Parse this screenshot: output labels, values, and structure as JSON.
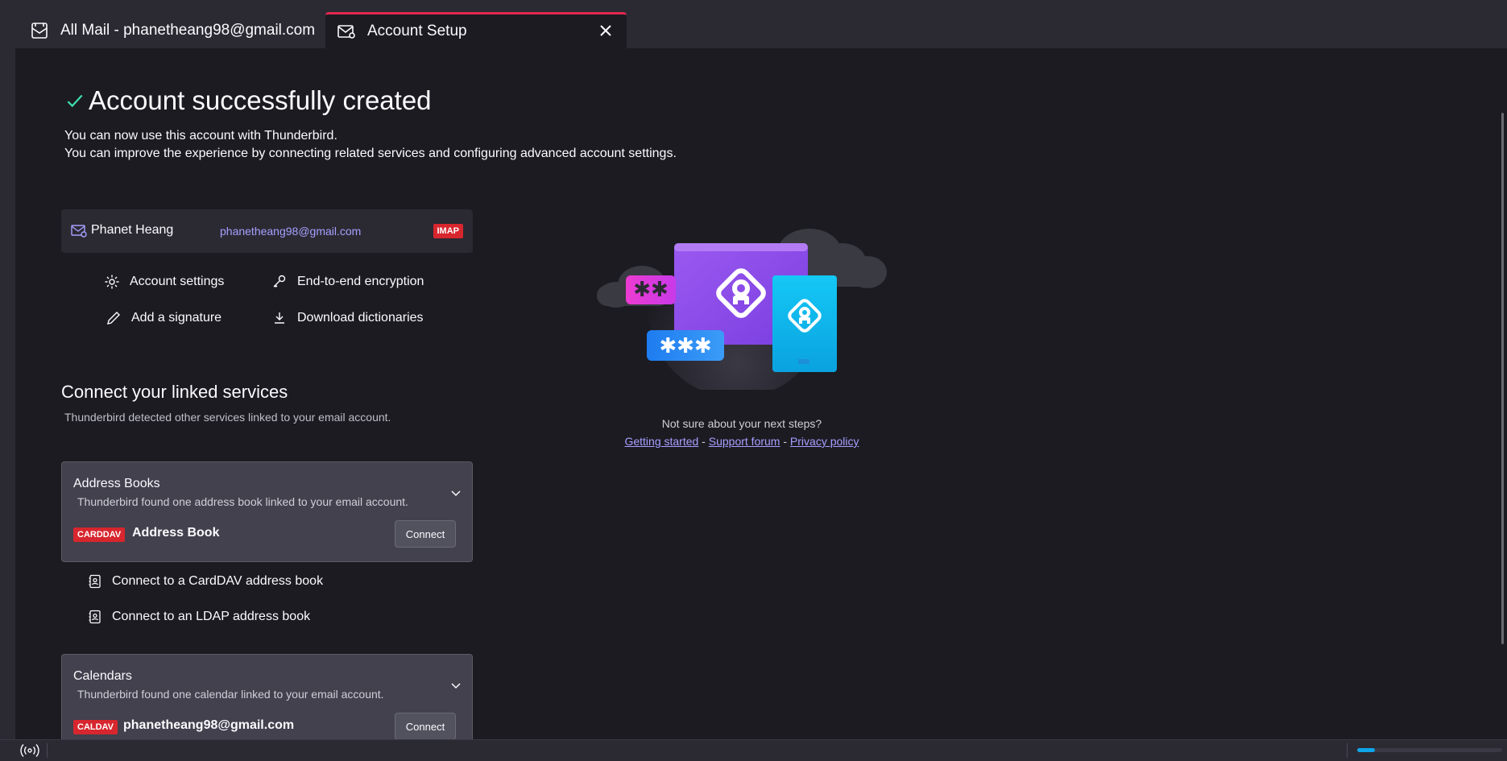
{
  "tabs": [
    {
      "label": "All Mail - phanetheang98@gmail.com",
      "icon": "mail-icon",
      "active": false
    },
    {
      "label": "Account Setup",
      "icon": "mail-setup-icon",
      "active": true
    }
  ],
  "header": {
    "title": "Account successfully created",
    "line1": "You can now use this account with Thunderbird.",
    "line2": "You can improve the experience by connecting related services and configuring advanced account settings."
  },
  "account": {
    "name": "Phanet Heang",
    "email": "phanetheang98@gmail.com",
    "protocol": "IMAP"
  },
  "actions": {
    "account_settings": "Account settings",
    "encryption": "End-to-end encryption",
    "signature": "Add a signature",
    "dictionaries": "Download dictionaries"
  },
  "linked": {
    "title": "Connect your linked services",
    "description": "Thunderbird detected other services linked to your email account."
  },
  "address_books": {
    "title": "Address Books",
    "description": "Thunderbird found one address book linked to your email account.",
    "tag": "CARDDAV",
    "item": "Address Book",
    "connect_label": "Connect"
  },
  "address_book_links": {
    "carddav": "Connect to a CardDAV address book",
    "ldap": "Connect to an LDAP address book"
  },
  "calendars": {
    "title": "Calendars",
    "description": "Thunderbird found one calendar linked to your email account.",
    "tag": "CALDAV",
    "item": "phanetheang98@gmail.com",
    "connect_label": "Connect"
  },
  "help": {
    "question": "Not sure about your next steps?",
    "getting_started": "Getting started",
    "support_forum": "Support forum",
    "privacy_policy": "Privacy policy",
    "separator": " - "
  },
  "status": {
    "progress_fraction": 0.12
  },
  "colors": {
    "accent_tab": "#e22850",
    "link": "#a6a0ff",
    "tag_red": "#d7262e",
    "check_green": "#3fe1b0",
    "progress_blue": "#0ea5e9"
  }
}
